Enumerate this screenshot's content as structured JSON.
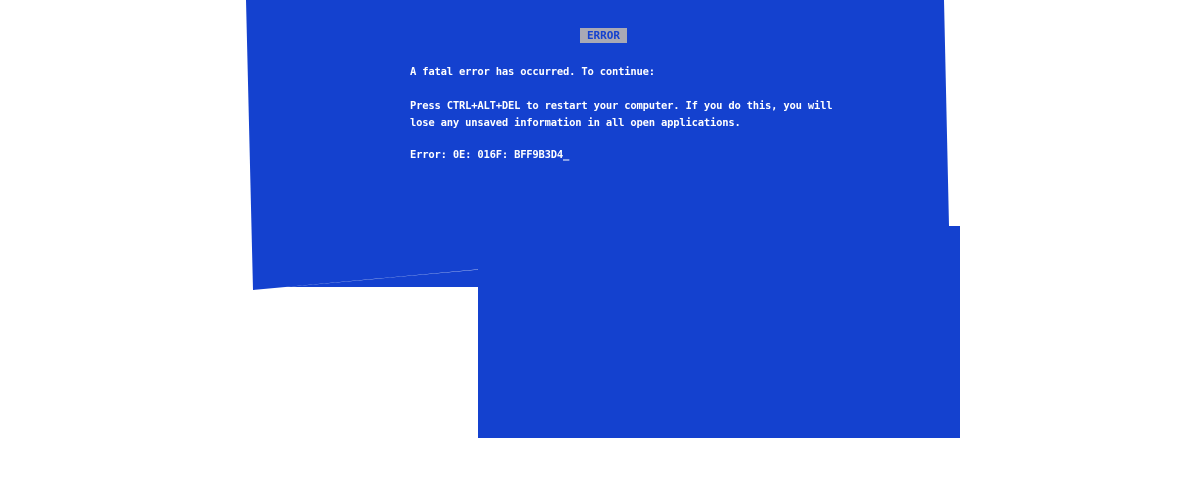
{
  "screen": {
    "badge": "ERROR",
    "line_1": "A fatal error has occurred. To continue:",
    "line_2a": "Press CTRL+ALT+DEL to restart your computer. If you do this, you will",
    "line_2b": "lose any unsaved information in all open applications.",
    "error_code": "Error: 0E: 016F: BFF9B3D4_"
  },
  "colors": {
    "background": "#1441cf",
    "text": "#ffffff",
    "badge_background": "#a9a9b5"
  }
}
